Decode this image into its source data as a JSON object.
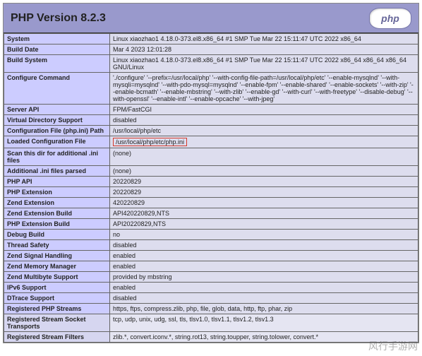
{
  "header": {
    "title": "PHP Version 8.2.3",
    "logo_text": "php"
  },
  "rows": [
    {
      "label": "System",
      "value": "Linux xiaozhao1 4.18.0-373.el8.x86_64 #1 SMP Tue Mar 22 15:11:47 UTC 2022 x86_64"
    },
    {
      "label": "Build Date",
      "value": "Mar 4 2023 12:01:28"
    },
    {
      "label": "Build System",
      "value": "Linux xiaozhao1 4.18.0-373.el8.x86_64 #1 SMP Tue Mar 22 15:11:47 UTC 2022 x86_64 x86_64 x86_64 GNU/Linux"
    },
    {
      "label": "Configure Command",
      "value": "'./configure' '--prefix=/usr/local/php' '--with-config-file-path=/usr/local/php/etc' '--enable-mysqlnd' '--with-mysqli=mysqlnd' '--with-pdo-mysql=mysqlnd' '--enable-fpm' '--enable-shared' '--enable-sockets' '--with-zip' '--enable-bcmath' '--enable-mbstring' '--with-zlib' '--enable-gd' '--with-curl' '--with-freetype' '--disable-debug' '--with-openssl' '--enable-intl' '--enable-opcache' '--with-jpeg'"
    },
    {
      "label": "Server API",
      "value": "FPM/FastCGI"
    },
    {
      "label": "Virtual Directory Support",
      "value": "disabled"
    },
    {
      "label": "Configuration File (php.ini) Path",
      "value": "/usr/local/php/etc"
    },
    {
      "label": "Loaded Configuration File",
      "value": "/usr/local/php/etc/php.ini",
      "highlight": true
    },
    {
      "label": "Scan this dir for additional .ini files",
      "value": "(none)"
    },
    {
      "label": "Additional .ini files parsed",
      "value": "(none)"
    },
    {
      "label": "PHP API",
      "value": "20220829"
    },
    {
      "label": "PHP Extension",
      "value": "20220829"
    },
    {
      "label": "Zend Extension",
      "value": "420220829"
    },
    {
      "label": "Zend Extension Build",
      "value": "API420220829,NTS"
    },
    {
      "label": "PHP Extension Build",
      "value": "API20220829,NTS"
    },
    {
      "label": "Debug Build",
      "value": "no"
    },
    {
      "label": "Thread Safety",
      "value": "disabled"
    },
    {
      "label": "Zend Signal Handling",
      "value": "enabled"
    },
    {
      "label": "Zend Memory Manager",
      "value": "enabled"
    },
    {
      "label": "Zend Multibyte Support",
      "value": "provided by mbstring"
    },
    {
      "label": "IPv6 Support",
      "value": "enabled"
    },
    {
      "label": "DTrace Support",
      "value": "disabled"
    },
    {
      "label": "Registered PHP Streams",
      "value": "https, ftps, compress.zlib, php, file, glob, data, http, ftp, phar, zip"
    },
    {
      "label": "Registered Stream Socket Transports",
      "value": "tcp, udp, unix, udg, ssl, tls, tlsv1.0, tlsv1.1, tlsv1.2, tlsv1.3",
      "reg": true
    },
    {
      "label": "Registered Stream Filters",
      "value": "zlib.*, convert.iconv.*, string.rot13, string.toupper, string.tolower, convert.*",
      "reg": true
    }
  ],
  "watermark": "风行手游网"
}
